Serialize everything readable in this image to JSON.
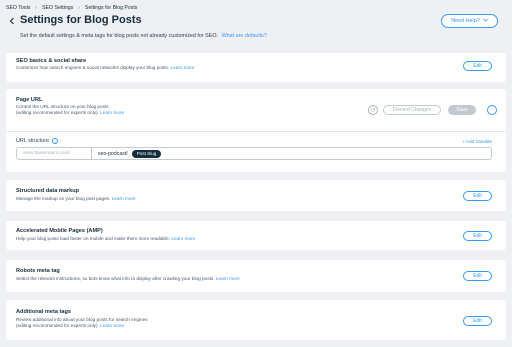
{
  "breadcrumb": [
    "SEO Tools",
    "SEO Settings",
    "Settings for Blog Posts"
  ],
  "page": {
    "title": "Settings for Blog Posts",
    "subtitle": "Set the default settings & meta tags for blog posts not already customized for SEO.",
    "subtitle_link": "What are defaults?",
    "help_label": "Need Help?"
  },
  "sections": {
    "seo_basics": {
      "title": "SEO basics & social share",
      "desc": "Customize how search engines & social networks display your blog posts.",
      "learn_more": "Learn more",
      "edit": "Edit"
    },
    "page_url": {
      "title": "Page URL",
      "desc_line1": "Control the URL structure on your blog posts",
      "desc_line2": "(editing recommended for experts only).",
      "learn_more": "Learn more",
      "discard": "Discard Changes",
      "save": "Save",
      "url_structure_label": "URL structure",
      "add_variable": "+ Add Variable",
      "url_domain": "www.theseoraint.com/",
      "url_prefix": "seo-podcast/",
      "slug_chip": "Post Slug"
    },
    "structured_data": {
      "title": "Structured data markup",
      "desc": "Manage the markup on your blog post pages.",
      "learn_more": "Learn more",
      "edit": "Edit"
    },
    "amp": {
      "title": "Accelerated Mobile Pages (AMP)",
      "desc": "Help your blog posts load faster on mobile and make them more readable.",
      "learn_more": "Learn more",
      "edit": "Edit"
    },
    "robots": {
      "title": "Robots meta tag",
      "desc": "Select the relevant instructions, so bots know what info to display after crawling your blog posts.",
      "learn_more": "Learn more",
      "edit": "Edit"
    },
    "additional_meta": {
      "title": "Additional meta tags",
      "desc_line1": "Review additional info about your blog posts for search engines",
      "desc_line2": "(editing recommended for experts only).",
      "learn_more": "Learn more",
      "edit": "Edit"
    }
  },
  "icons": {
    "back": "back-arrow-icon",
    "help_chevron": "chevron-down-icon",
    "reset": "reset-icon",
    "more": "more-icon",
    "info": "info-icon"
  },
  "colors": {
    "accent": "#3899ec",
    "background": "#eef0f4",
    "chip": "#162d3d"
  }
}
